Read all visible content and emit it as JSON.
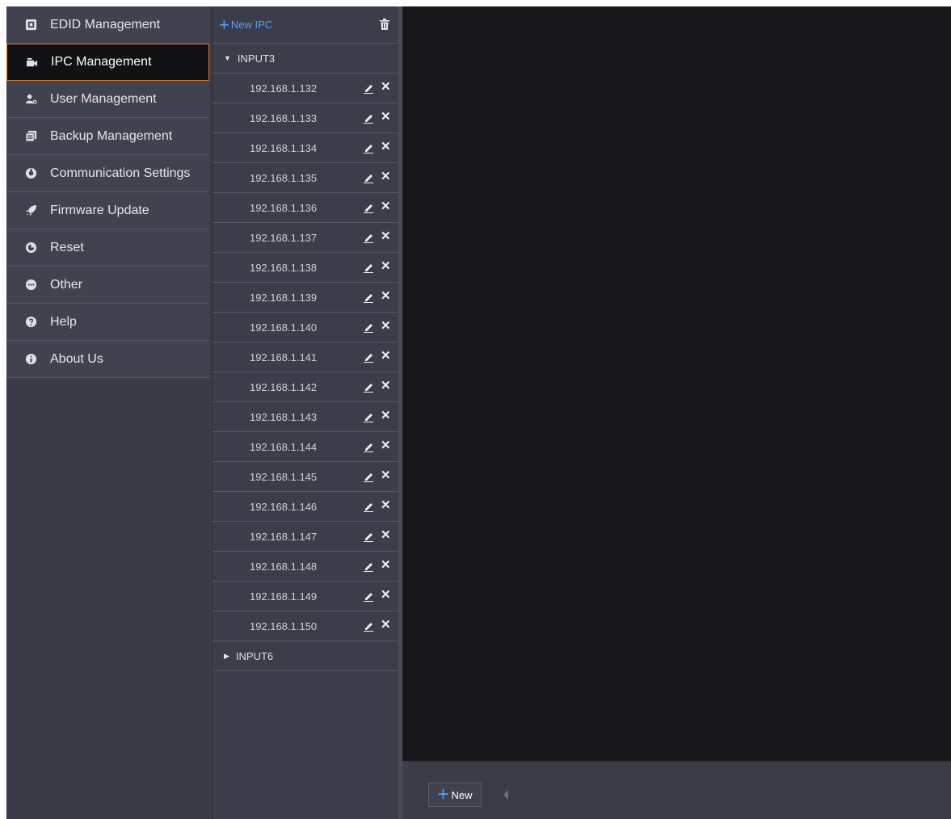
{
  "sidebar": {
    "items": [
      {
        "label": "EDID Management",
        "icon": "edid-icon",
        "active": false
      },
      {
        "label": "IPC Management",
        "icon": "camera-icon",
        "active": true
      },
      {
        "label": "User Management",
        "icon": "user-icon",
        "active": false
      },
      {
        "label": "Backup Management",
        "icon": "backup-icon",
        "active": false
      },
      {
        "label": "Communication Settings",
        "icon": "communication-icon",
        "active": false
      },
      {
        "label": "Firmware Update",
        "icon": "rocket-icon",
        "active": false
      },
      {
        "label": "Reset",
        "icon": "reset-icon",
        "active": false
      },
      {
        "label": "Other",
        "icon": "more-icon",
        "active": false
      },
      {
        "label": "Help",
        "icon": "help-icon",
        "active": false
      },
      {
        "label": "About Us",
        "icon": "info-icon",
        "active": false
      }
    ]
  },
  "ipc_panel": {
    "new_ipc_label": "New IPC",
    "groups": [
      {
        "name": "INPUT3",
        "expanded": true,
        "ips": [
          "192.168.1.132",
          "192.168.1.133",
          "192.168.1.134",
          "192.168.1.135",
          "192.168.1.136",
          "192.168.1.137",
          "192.168.1.138",
          "192.168.1.139",
          "192.168.1.140",
          "192.168.1.141",
          "192.168.1.142",
          "192.168.1.143",
          "192.168.1.144",
          "192.168.1.145",
          "192.168.1.146",
          "192.168.1.147",
          "192.168.1.148",
          "192.168.1.149",
          "192.168.1.150"
        ]
      },
      {
        "name": "INPUT6",
        "expanded": false,
        "ips": []
      }
    ]
  },
  "bottom_bar": {
    "new_label": "New"
  },
  "colors": {
    "accent": "#4aa3ff",
    "active_border": "#d77a2c"
  }
}
